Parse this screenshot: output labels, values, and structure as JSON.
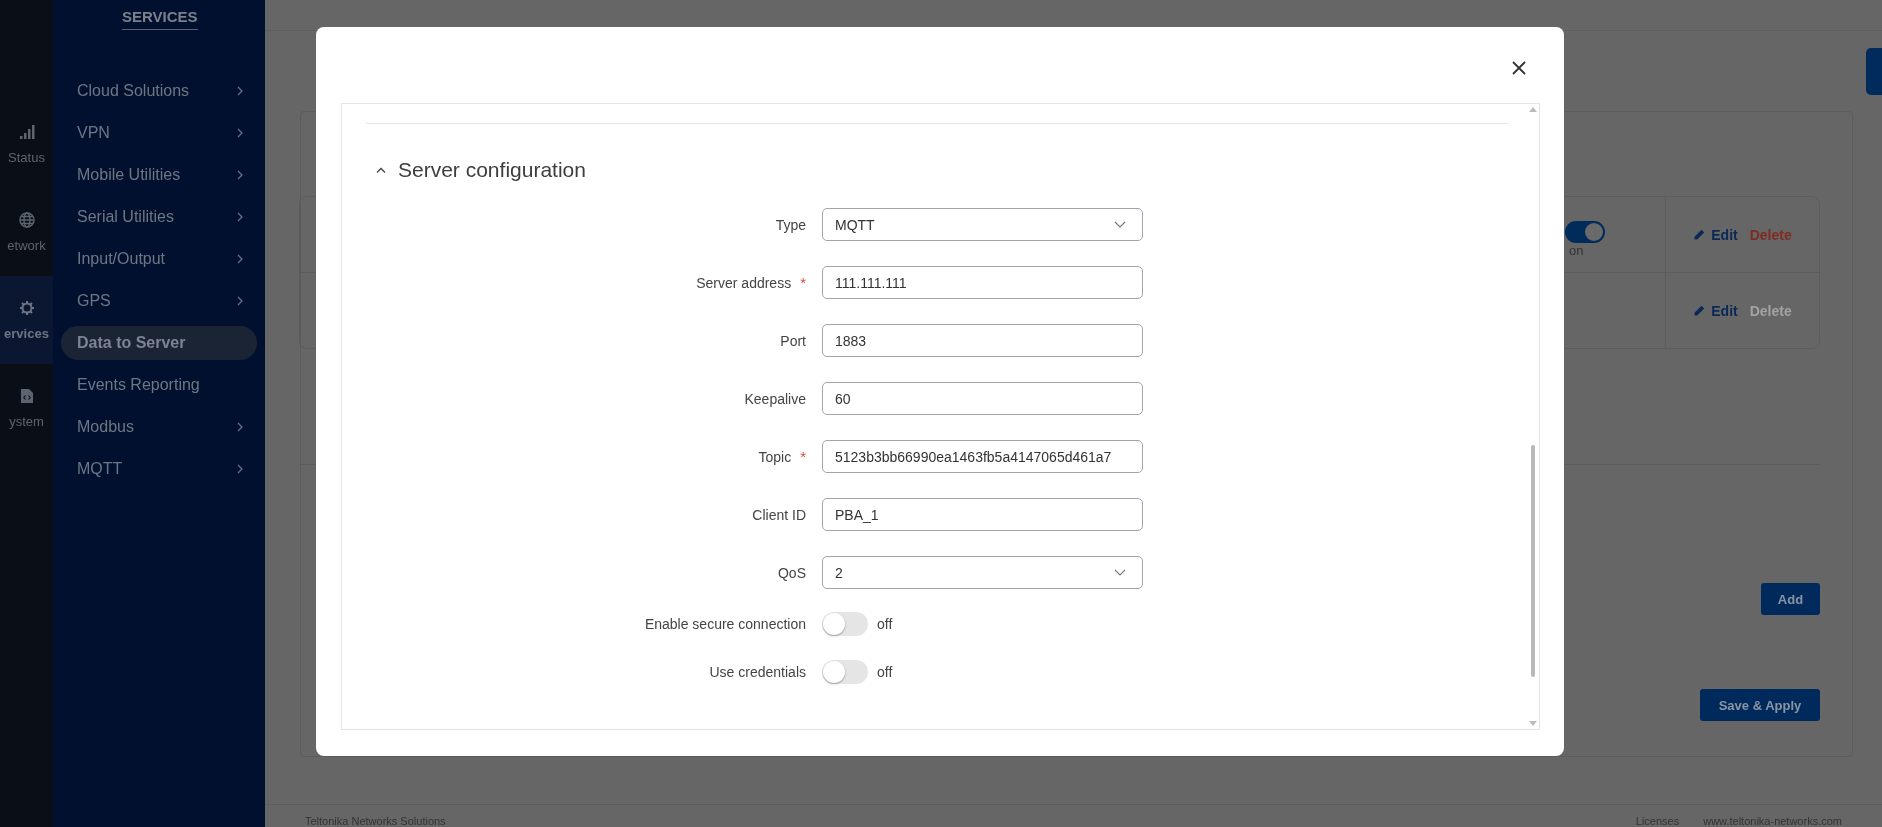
{
  "rail": [
    {
      "kind": "signal",
      "label": "Status",
      "selected": false
    },
    {
      "kind": "globe",
      "label": "etwork",
      "selected": false
    },
    {
      "kind": "gear",
      "label": "ervices",
      "selected": true
    },
    {
      "kind": "file",
      "label": "ystem",
      "selected": false
    }
  ],
  "sidebar": {
    "title": "SERVICES",
    "items": [
      {
        "label": "Cloud Solutions",
        "has_submenu": true,
        "selected": false
      },
      {
        "label": "VPN",
        "has_submenu": true,
        "selected": false
      },
      {
        "label": "Mobile Utilities",
        "has_submenu": true,
        "selected": false
      },
      {
        "label": "Serial Utilities",
        "has_submenu": true,
        "selected": false
      },
      {
        "label": "Input/Output",
        "has_submenu": true,
        "selected": false
      },
      {
        "label": "GPS",
        "has_submenu": true,
        "selected": false
      },
      {
        "label": "Data to Server",
        "has_submenu": false,
        "selected": true
      },
      {
        "label": "Events Reporting",
        "has_submenu": false,
        "selected": false
      },
      {
        "label": "Modbus",
        "has_submenu": true,
        "selected": false
      },
      {
        "label": "MQTT",
        "has_submenu": true,
        "selected": false
      }
    ]
  },
  "background": {
    "rows": [
      {
        "toggle": {
          "on": true,
          "state_text": "on"
        },
        "edit": "Edit",
        "delete": "Delete",
        "delete_enabled": true
      },
      {
        "edit": "Edit",
        "delete": "Delete",
        "delete_enabled": false
      }
    ],
    "add_button": "Add",
    "save_button": "Save & Apply"
  },
  "footer": {
    "left": "Teltonika Networks Solutions",
    "links": [
      "Licenses",
      "www.teltonika-networks.com"
    ]
  },
  "modal": {
    "section": {
      "title": "Server configuration",
      "expanded": true
    },
    "fields": [
      {
        "kind": "select",
        "label": "Type",
        "value": "MQTT"
      },
      {
        "kind": "text",
        "label": "Server address",
        "value": "111.111.111",
        "required_mark": "*"
      },
      {
        "kind": "text",
        "label": "Port",
        "value": "1883"
      },
      {
        "kind": "text",
        "label": "Keepalive",
        "value": "60"
      },
      {
        "kind": "text",
        "label": "Topic",
        "value": "5123b3bb66990ea1463fb5a4147065d461a7",
        "required_mark": "*"
      },
      {
        "kind": "text",
        "label": "Client ID",
        "value": "PBA_1"
      },
      {
        "kind": "select",
        "label": "QoS",
        "value": "2"
      },
      {
        "kind": "toggle",
        "label": "Enable secure connection",
        "on": false,
        "state_text": "off"
      },
      {
        "kind": "toggle",
        "label": "Use credentials",
        "on": false,
        "state_text": "off"
      }
    ]
  }
}
